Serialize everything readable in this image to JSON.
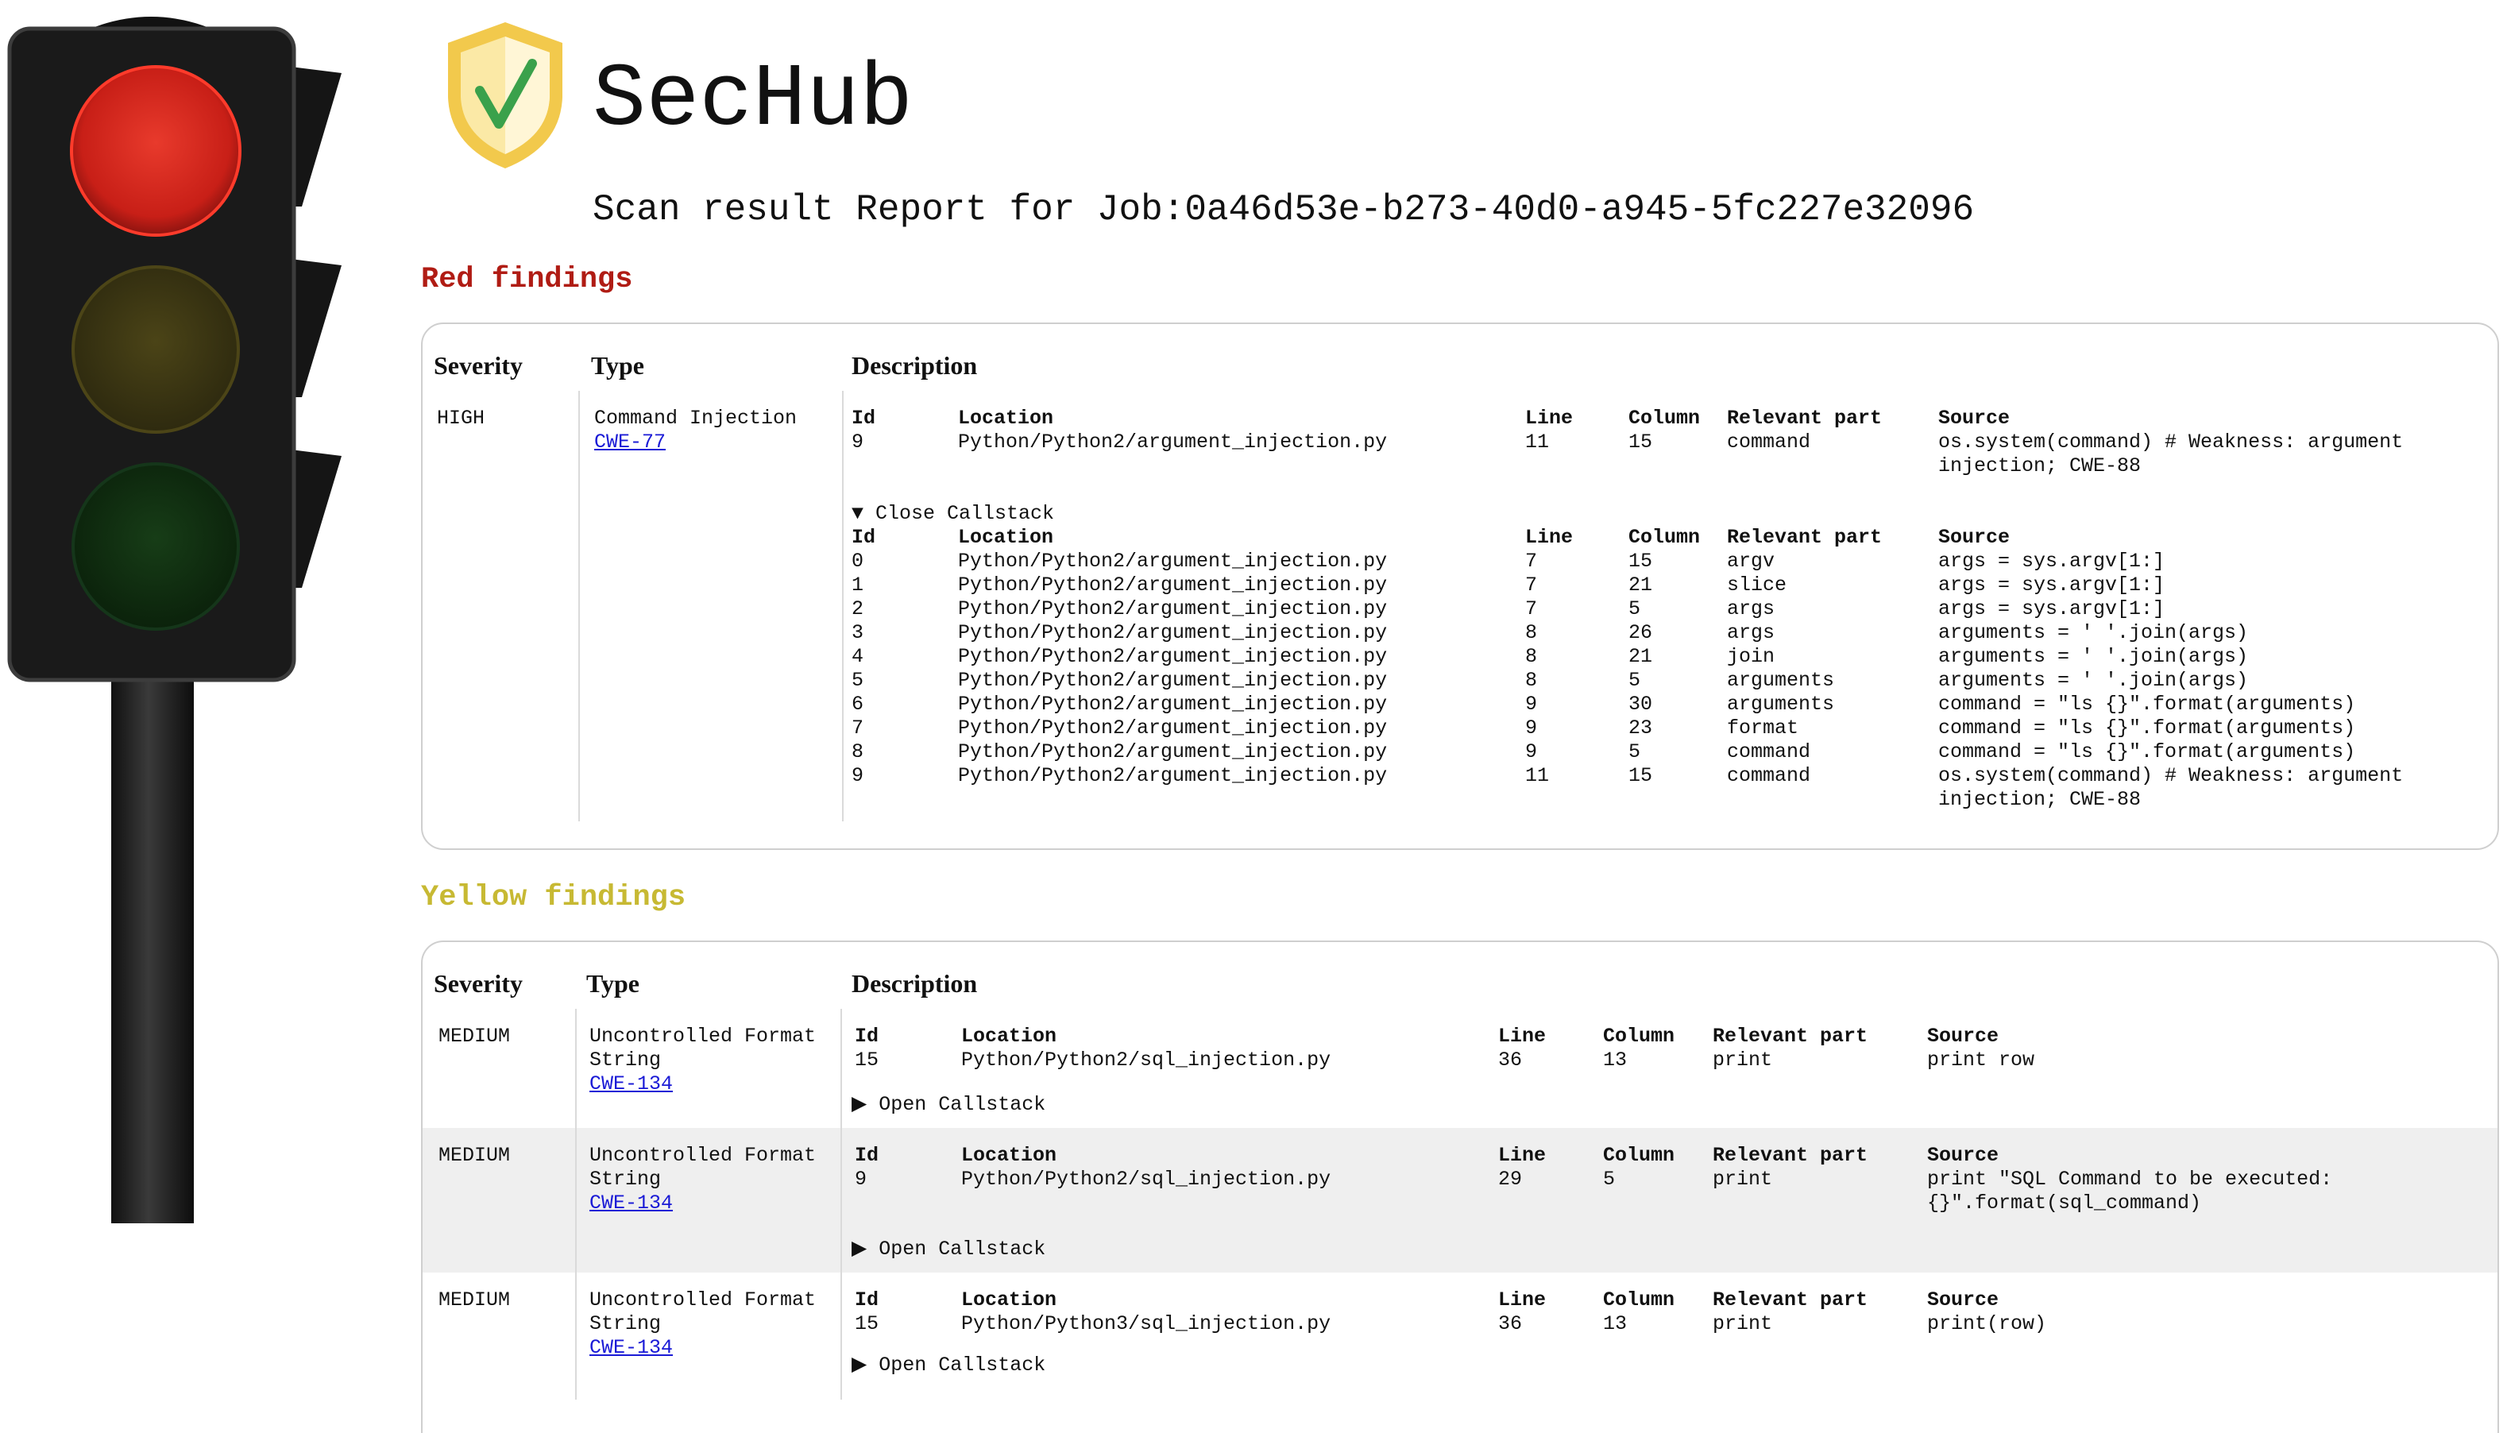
{
  "app": {
    "title": "SecHub",
    "report_title": "Scan result Report for Job:0a46d53e-b273-40d0-a945-5fc227e32096"
  },
  "colors": {
    "red": "#b01c14",
    "yellow": "#c7b933",
    "link": "#1a1ad6"
  },
  "icons": [
    "traffic-light-icon",
    "shield-check-icon"
  ],
  "columns": {
    "severity": "Severity",
    "type": "Type",
    "description": "Description"
  },
  "detail_headers": {
    "id": "Id",
    "location": "Location",
    "line": "Line",
    "column": "Column",
    "relevant": "Relevant part",
    "source": "Source"
  },
  "red": {
    "heading": "Red findings",
    "findings": [
      {
        "severity": "HIGH",
        "type": "Command Injection",
        "cwe": "CWE-77",
        "main": {
          "id": "9",
          "location": "Python/Python2/argument_injection.py",
          "line": "11",
          "column": "15",
          "relevant": "command",
          "source": "os.system(command) # Weakness: argument injection; CWE-88"
        },
        "callstack_toggle": "▼ Close Callstack",
        "callstack": [
          {
            "id": "0",
            "location": "Python/Python2/argument_injection.py",
            "line": "7",
            "column": "15",
            "relevant": "argv",
            "source": "args = sys.argv[1:]"
          },
          {
            "id": "1",
            "location": "Python/Python2/argument_injection.py",
            "line": "7",
            "column": "21",
            "relevant": "slice",
            "source": "args = sys.argv[1:]"
          },
          {
            "id": "2",
            "location": "Python/Python2/argument_injection.py",
            "line": "7",
            "column": "5",
            "relevant": "args",
            "source": "args = sys.argv[1:]"
          },
          {
            "id": "3",
            "location": "Python/Python2/argument_injection.py",
            "line": "8",
            "column": "26",
            "relevant": "args",
            "source": "arguments = ' '.join(args)"
          },
          {
            "id": "4",
            "location": "Python/Python2/argument_injection.py",
            "line": "8",
            "column": "21",
            "relevant": "join",
            "source": "arguments = ' '.join(args)"
          },
          {
            "id": "5",
            "location": "Python/Python2/argument_injection.py",
            "line": "8",
            "column": "5",
            "relevant": "arguments",
            "source": "arguments = ' '.join(args)"
          },
          {
            "id": "6",
            "location": "Python/Python2/argument_injection.py",
            "line": "9",
            "column": "30",
            "relevant": "arguments",
            "source": "command = \"ls {}\".format(arguments)"
          },
          {
            "id": "7",
            "location": "Python/Python2/argument_injection.py",
            "line": "9",
            "column": "23",
            "relevant": "format",
            "source": "command = \"ls {}\".format(arguments)"
          },
          {
            "id": "8",
            "location": "Python/Python2/argument_injection.py",
            "line": "9",
            "column": "5",
            "relevant": "command",
            "source": "command = \"ls {}\".format(arguments)"
          },
          {
            "id": "9",
            "location": "Python/Python2/argument_injection.py",
            "line": "11",
            "column": "15",
            "relevant": "command",
            "source": "os.system(command) # Weakness: argument injection; CWE-88"
          }
        ]
      }
    ]
  },
  "yellow": {
    "heading": "Yellow findings",
    "findings": [
      {
        "severity": "MEDIUM",
        "type": "Uncontrolled Format String",
        "cwe": "CWE-134",
        "main": {
          "id": "15",
          "location": "Python/Python2/sql_injection.py",
          "line": "36",
          "column": "13",
          "relevant": "print",
          "source": "print row"
        },
        "callstack_toggle": "▶ Open Callstack"
      },
      {
        "severity": "MEDIUM",
        "type": "Uncontrolled Format String",
        "cwe": "CWE-134",
        "main": {
          "id": "9",
          "location": "Python/Python2/sql_injection.py",
          "line": "29",
          "column": "5",
          "relevant": "print",
          "source": "print \"SQL Command to be executed: {}\".format(sql_command)"
        },
        "callstack_toggle": "▶ Open Callstack"
      },
      {
        "severity": "MEDIUM",
        "type": "Uncontrolled Format String",
        "cwe": "CWE-134",
        "main": {
          "id": "15",
          "location": "Python/Python3/sql_injection.py",
          "line": "36",
          "column": "13",
          "relevant": "print",
          "source": "print(row)"
        },
        "callstack_toggle": "▶ Open Callstack"
      }
    ]
  }
}
